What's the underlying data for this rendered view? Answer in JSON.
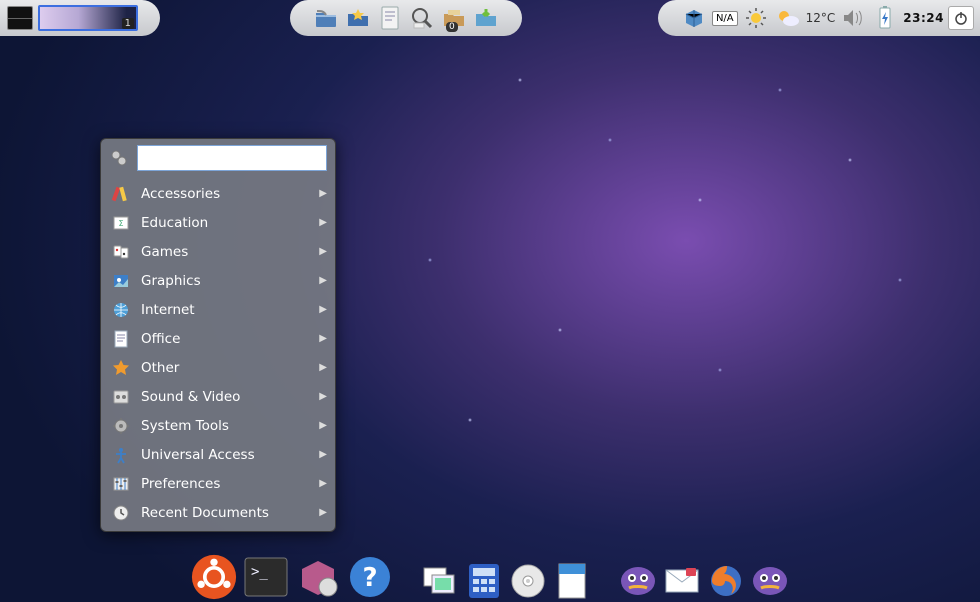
{
  "panel": {
    "workspace_num": "1",
    "updates_badge": "0",
    "na_label": "N/A",
    "temperature": "12°C",
    "clock": "23:24",
    "launchers": {
      "file_manager": "file-manager",
      "bookmarks": "bookmarks",
      "text_editor": "text-editor",
      "search": "search",
      "downloads": "downloads"
    },
    "tray": {
      "packages": "packages",
      "weather_sun": "weather-sunny",
      "weather_partly": "weather-partly-sunny",
      "volume": "volume",
      "battery": "battery-charging",
      "shutdown": "shutdown"
    }
  },
  "menu": {
    "search_value": "",
    "items": [
      {
        "label": "Accessories",
        "icon": "accessories"
      },
      {
        "label": "Education",
        "icon": "education"
      },
      {
        "label": "Games",
        "icon": "games"
      },
      {
        "label": "Graphics",
        "icon": "graphics"
      },
      {
        "label": "Internet",
        "icon": "internet"
      },
      {
        "label": "Office",
        "icon": "office"
      },
      {
        "label": "Other",
        "icon": "other"
      },
      {
        "label": "Sound & Video",
        "icon": "sound-video"
      },
      {
        "label": "System Tools",
        "icon": "system-tools"
      },
      {
        "label": "Universal Access",
        "icon": "universal-access"
      },
      {
        "label": "Preferences",
        "icon": "preferences"
      },
      {
        "label": "Recent Documents",
        "icon": "recent-documents"
      }
    ]
  },
  "dock": {
    "items": [
      {
        "name": "ubuntu-logo"
      },
      {
        "name": "terminal"
      },
      {
        "name": "software-center"
      },
      {
        "name": "help"
      },
      {
        "name": "image-viewer"
      },
      {
        "name": "calculator"
      },
      {
        "name": "disc"
      },
      {
        "name": "document"
      },
      {
        "name": "messenger"
      },
      {
        "name": "mail"
      },
      {
        "name": "firefox"
      },
      {
        "name": "messenger-2"
      }
    ]
  }
}
